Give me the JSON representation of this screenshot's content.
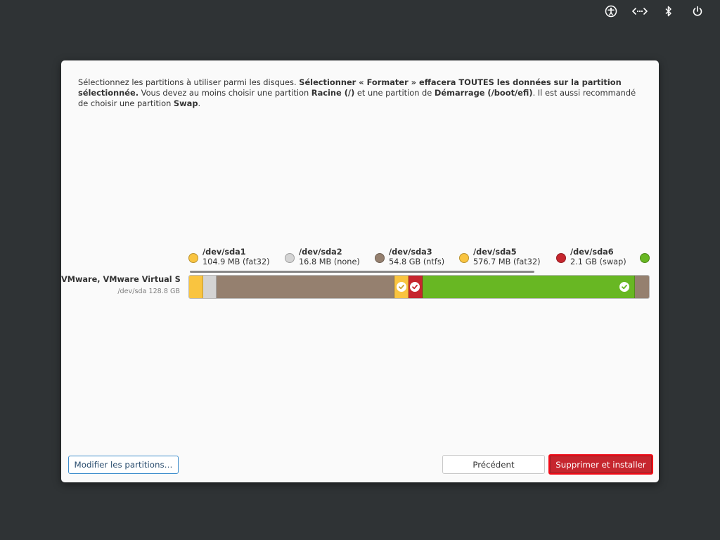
{
  "panel": {
    "icons": [
      "accessibility-icon",
      "network-icon",
      "bluetooth-icon",
      "power-icon"
    ]
  },
  "instructions": {
    "p1_a": "Sélectionnez les partitions à utiliser parmi les disques. ",
    "p1_b": "Sélectionner « Formater » effacera TOUTES les données sur la partition sélectionnée.",
    "p2_a": " Vous devez au moins choisir une partition ",
    "p2_b": "Racine (/)",
    "p2_c": " et une partition de ",
    "p2_d": "Démarrage (/boot/efi)",
    "p2_e": ". Il est aussi recommandé de choisir une partition ",
    "p2_f": "Swap",
    "p2_g": "."
  },
  "disk": {
    "name": "VMware, VMware Virtual S",
    "device": "/dev/sda 128.8 GB"
  },
  "partitions": [
    {
      "name": "/dev/sda1",
      "info": "104.9 MB (fat32)",
      "color": "#f9c440"
    },
    {
      "name": "/dev/sda2",
      "info": "16.8 MB (none)",
      "color": "#d4d4d4"
    },
    {
      "name": "/dev/sda3",
      "info": "54.8 GB (ntfs)",
      "color": "#95806f"
    },
    {
      "name": "/dev/sda5",
      "info": "576.7 MB (fat32)",
      "color": "#f9c440"
    },
    {
      "name": "/dev/sda6",
      "info": "2.1 GB (swap)",
      "color": "#c6262e"
    },
    {
      "name": "",
      "info": "",
      "color": "#68b723"
    }
  ],
  "bar_segments": [
    {
      "color": "#f9c440",
      "share": 0.03,
      "checked": false
    },
    {
      "color": "#d4d4d4",
      "share": 0.03,
      "checked": false
    },
    {
      "color": "#95806f",
      "share": 0.387,
      "checked": false
    },
    {
      "color": "#f9c440",
      "share": 0.03,
      "checked": true,
      "check_color": "#c9a032"
    },
    {
      "color": "#c6262e",
      "share": 0.03,
      "checked": true,
      "check_color": "#c6262e"
    },
    {
      "color": "#68b723",
      "share": 0.463,
      "checked": true,
      "check_color": "#68b723"
    },
    {
      "color": "#95806f",
      "share": 0.03,
      "checked": false
    }
  ],
  "buttons": {
    "modify": "Modifier les partitions…",
    "previous": "Précédent",
    "install": "Supprimer et installer"
  }
}
